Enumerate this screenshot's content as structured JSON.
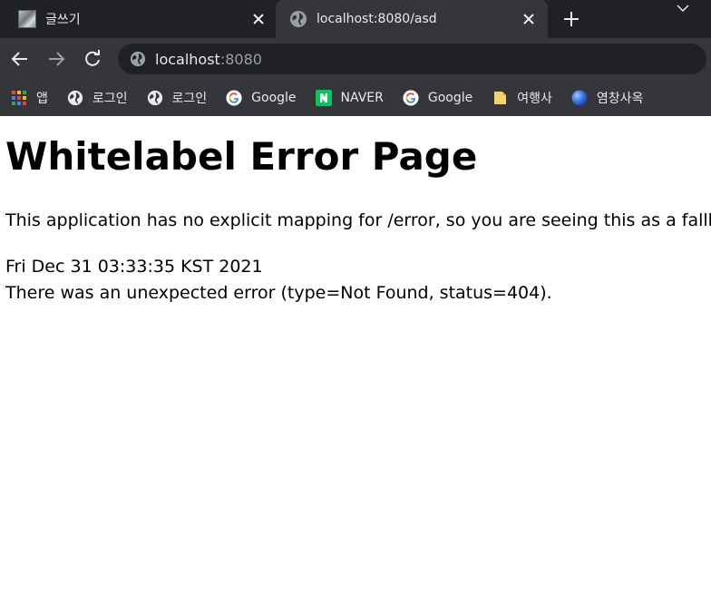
{
  "tabs": [
    {
      "title": "글쓰기",
      "favicon": "thumbnail-image-icon"
    },
    {
      "title": "localhost:8080/asd",
      "favicon": "globe-icon"
    }
  ],
  "omnibox": {
    "host": "localhost",
    "port": ":8080"
  },
  "bookmarks": [
    {
      "label": "앱",
      "icon": "apps-grid-icon"
    },
    {
      "label": "로그인",
      "icon": "globe-icon"
    },
    {
      "label": "로그인",
      "icon": "globe-icon"
    },
    {
      "label": "Google",
      "icon": "google-icon"
    },
    {
      "label": "NAVER",
      "icon": "naver-icon"
    },
    {
      "label": "Google",
      "icon": "google-icon"
    },
    {
      "label": "여행사",
      "icon": "folder-icon"
    },
    {
      "label": "염창사옥",
      "icon": "blue-sphere-icon"
    }
  ],
  "page": {
    "title": "Whitelabel Error Page",
    "description": "This application has no explicit mapping for /error, so you are seeing this as a fallback.",
    "timestamp": "Fri Dec 31 03:33:35 KST 2021",
    "error": "There was an unexpected error (type=Not Found, status=404)."
  },
  "colors": {
    "tabstrip": "#202124",
    "active_tab": "#35363a",
    "omnibox": "#202124",
    "text": "#e8eaed",
    "muted_text": "#9aa0a6",
    "naver_green": "#03c75a",
    "folder_yellow": "#f6d36b"
  }
}
